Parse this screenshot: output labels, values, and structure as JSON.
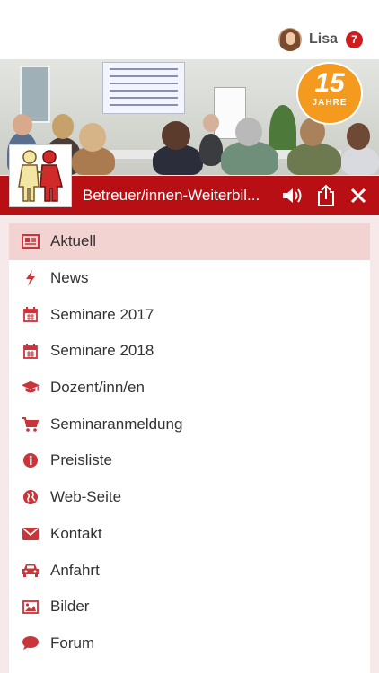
{
  "user": {
    "name": "Lisa",
    "badge_count": "7"
  },
  "hero": {
    "badge_number": "15",
    "badge_text": "JAHRE"
  },
  "header": {
    "title": "Betreuer/innen-Weiterbil..."
  },
  "colors": {
    "accent": "#b80f14",
    "active_bg": "#f3d2d2",
    "icon": "#c9353a",
    "page_bg": "#f7e9e9"
  },
  "menu": {
    "items": [
      {
        "label": "Aktuell",
        "icon": "newspaper-icon",
        "active": true
      },
      {
        "label": "News",
        "icon": "bolt-icon"
      },
      {
        "label": "Seminare 2017",
        "icon": "calendar-icon"
      },
      {
        "label": "Seminare 2018",
        "icon": "calendar-icon"
      },
      {
        "label": "Dozent/inn/en",
        "icon": "graduation-cap-icon"
      },
      {
        "label": "Seminaranmeldung",
        "icon": "cart-icon"
      },
      {
        "label": "Preisliste",
        "icon": "info-icon"
      },
      {
        "label": "Web-Seite",
        "icon": "globe-icon"
      },
      {
        "label": "Kontakt",
        "icon": "envelope-icon"
      },
      {
        "label": "Anfahrt",
        "icon": "car-icon"
      },
      {
        "label": "Bilder",
        "icon": "image-icon"
      },
      {
        "label": "Forum",
        "icon": "chat-bubble-icon"
      }
    ]
  }
}
